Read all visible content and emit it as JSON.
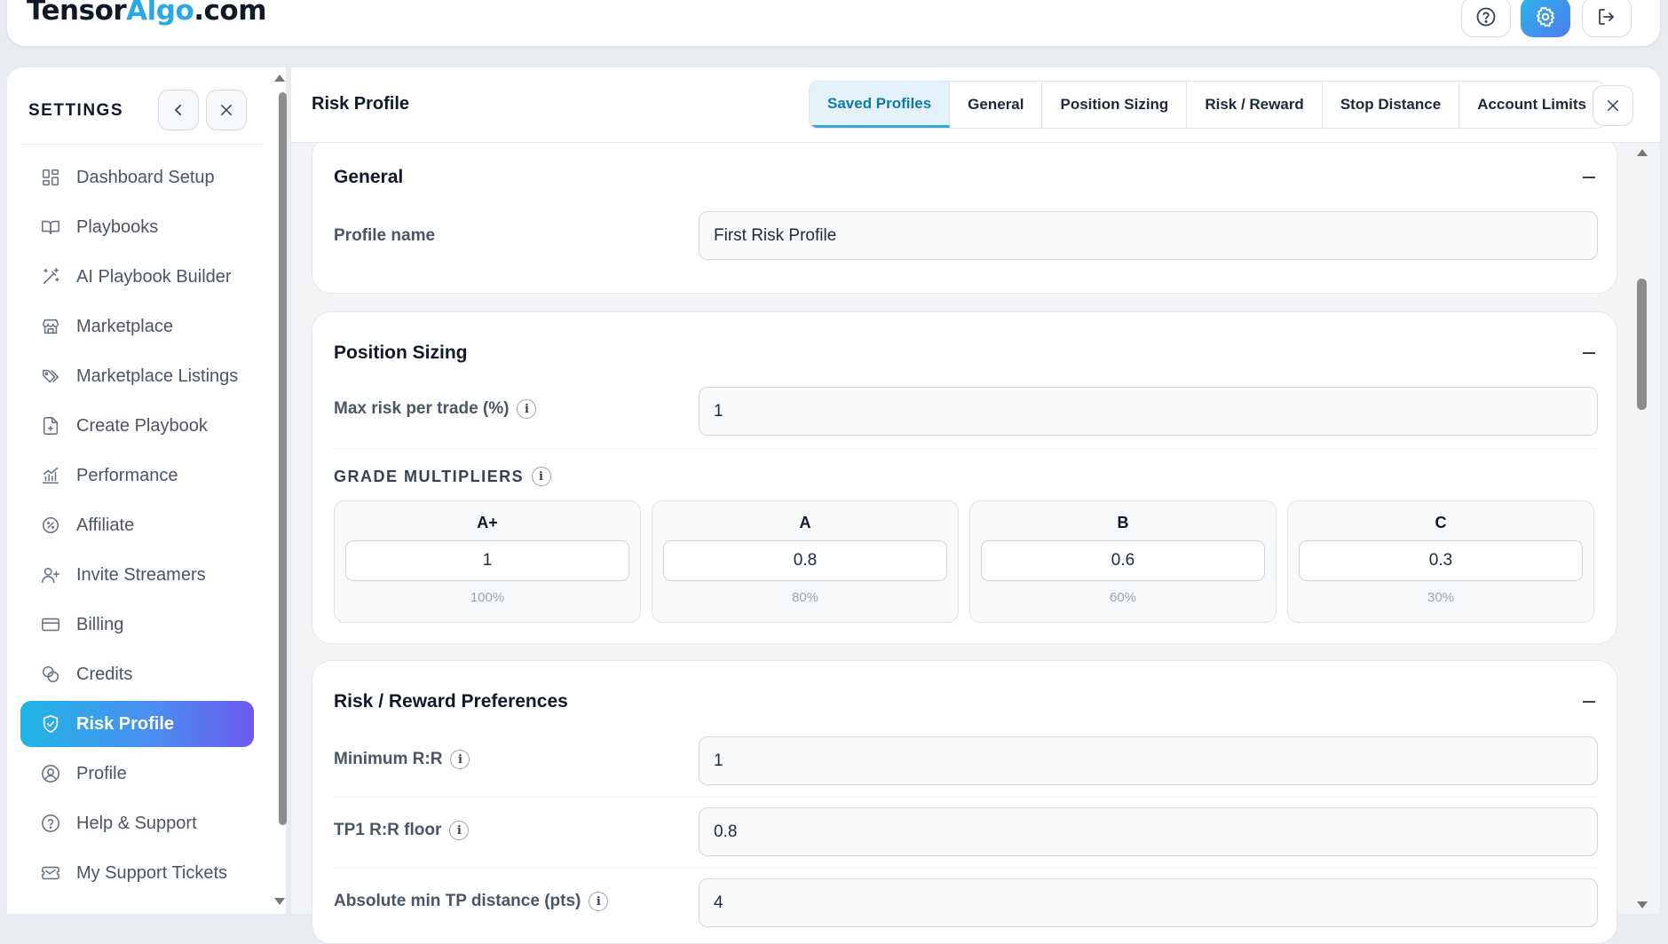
{
  "app": {
    "logo_main": "Tensor",
    "logo_accent": "Algo",
    "logo_suffix": ".com"
  },
  "topbar": {
    "help_icon": "help-circle-icon",
    "settings_icon": "gear-icon",
    "logout_icon": "logout-icon"
  },
  "sidebar": {
    "title": "SETTINGS",
    "items": [
      {
        "label": "Dashboard Setup",
        "icon": "dashboard-grid-icon"
      },
      {
        "label": "Playbooks",
        "icon": "book-open-icon"
      },
      {
        "label": "AI Playbook Builder",
        "icon": "magic-wand-icon"
      },
      {
        "label": "Marketplace",
        "icon": "store-icon"
      },
      {
        "label": "Marketplace Listings",
        "icon": "tags-icon"
      },
      {
        "label": "Create Playbook",
        "icon": "file-plus-icon"
      },
      {
        "label": "Performance",
        "icon": "bar-chart-icon"
      },
      {
        "label": "Affiliate",
        "icon": "badge-percent-icon"
      },
      {
        "label": "Invite Streamers",
        "icon": "user-plus-icon"
      },
      {
        "label": "Billing",
        "icon": "credit-card-icon"
      },
      {
        "label": "Credits",
        "icon": "coins-icon"
      },
      {
        "label": "Risk Profile",
        "icon": "shield-check-icon",
        "active": true
      },
      {
        "label": "Profile",
        "icon": "user-circle-icon"
      },
      {
        "label": "Help & Support",
        "icon": "help-circle-icon"
      },
      {
        "label": "My Support Tickets",
        "icon": "ticket-icon"
      }
    ]
  },
  "main": {
    "title": "Risk Profile",
    "tabs": [
      {
        "label": "Saved Profiles",
        "active": true
      },
      {
        "label": "General"
      },
      {
        "label": "Position Sizing"
      },
      {
        "label": "Risk / Reward"
      },
      {
        "label": "Stop Distance"
      },
      {
        "label": "Account Limits"
      }
    ]
  },
  "general": {
    "title": "General",
    "profile_name_label": "Profile name",
    "profile_name_value": "First Risk Profile"
  },
  "position_sizing": {
    "title": "Position Sizing",
    "max_risk_label": "Max risk per trade (%)",
    "max_risk_value": "1",
    "grade_multipliers_label": "GRADE MULTIPLIERS",
    "grades": [
      {
        "grade": "A+",
        "value": "1",
        "percent": "100%"
      },
      {
        "grade": "A",
        "value": "0.8",
        "percent": "80%"
      },
      {
        "grade": "B",
        "value": "0.6",
        "percent": "60%"
      },
      {
        "grade": "C",
        "value": "0.3",
        "percent": "30%"
      }
    ]
  },
  "risk_reward": {
    "title": "Risk / Reward Preferences",
    "min_rr_label": "Minimum R:R",
    "min_rr_value": "1",
    "tp1_floor_label": "TP1 R:R floor",
    "tp1_floor_value": "0.8",
    "abs_min_tp_label": "Absolute min TP distance (pts)",
    "abs_min_tp_value": "4"
  },
  "colors": {
    "accent": "#2aa8e6",
    "active_gradient_start": "#1fb6e6",
    "active_gradient_end": "#6a5af0"
  }
}
